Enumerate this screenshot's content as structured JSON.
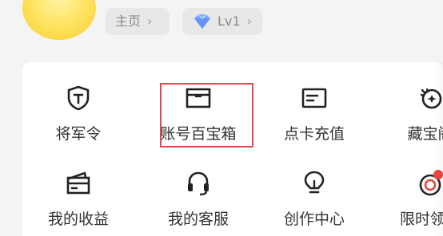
{
  "header": {
    "home_chip_label": "主页",
    "level_chip_label": "Lv1"
  },
  "grid": {
    "row1": [
      {
        "label": "将军令",
        "icon": "shield-t-icon"
      },
      {
        "label": "账号百宝箱",
        "icon": "treasure-box-icon"
      },
      {
        "label": "点卡充值",
        "icon": "card-recharge-icon"
      },
      {
        "label": "藏宝阁",
        "icon": "treasure-pavilion-icon"
      }
    ],
    "row2": [
      {
        "label": "我的收益",
        "icon": "wallet-icon"
      },
      {
        "label": "我的客服",
        "icon": "headset-icon"
      },
      {
        "label": "创作中心",
        "icon": "lightbulb-icon"
      },
      {
        "label": "限时领…",
        "icon": "limited-gift-icon"
      }
    ]
  },
  "colors": {
    "highlight": "#e04a4a",
    "accent_red": "#e5473e",
    "diamond": "#7fa6ff",
    "chip_bg": "#e8e8e8",
    "card_bg": "#ffffff",
    "page_bg": "#f4f4f4"
  }
}
